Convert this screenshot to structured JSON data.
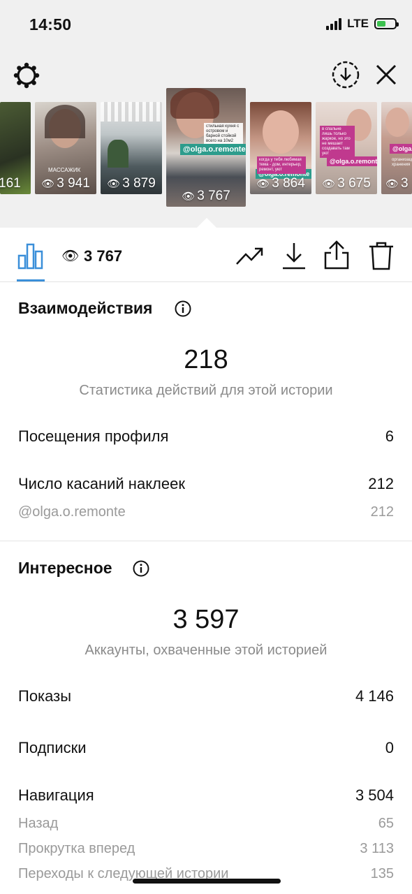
{
  "status_bar": {
    "time": "14:50",
    "network": "LTE",
    "battery_color": "#3cc14f"
  },
  "header": {
    "settings_icon": "gear-icon",
    "download_all_icon": "download-circle-icon",
    "close_icon": "close-icon"
  },
  "stories": [
    {
      "views": "161",
      "bg": "#3a4a2e"
    },
    {
      "views": "3 941",
      "bg": "#7a6e66",
      "caption": "МАССАЖИК"
    },
    {
      "views": "3 879",
      "bg": "#5a6a70"
    },
    {
      "views": "3 767",
      "bg": "#8a7f78",
      "handle": "@olga.o.remonte",
      "caption": "стильная кухня с островом и барной стойкой всего на 10м2",
      "selected": true
    },
    {
      "views": "3 864",
      "bg": "#a88c80",
      "handle": "@olga.o.remonte",
      "caption": "когда у тебя любимая тема - дом, интерьер, ремонт, уют"
    },
    {
      "views": "3 675",
      "bg": "#c9b8ae",
      "handle": "@olga.o.remonte",
      "caption": "в спальне лишь только жаркое, но это не мешает создавать там уют"
    },
    {
      "views": "3",
      "bg": "#b89a90",
      "handle": "@olga.o",
      "caption": "организация хранения"
    }
  ],
  "toolbar": {
    "views_count": "3 767",
    "active_tab_color": "#3b8fd9"
  },
  "interactions": {
    "title": "Взаимодействия",
    "total": "218",
    "caption": "Статистика действий для этой истории",
    "rows": [
      {
        "label": "Посещения профиля",
        "value": "6"
      },
      {
        "label": "Число касаний наклеек",
        "value": "212"
      }
    ],
    "sub_rows": [
      {
        "label": "@olga.o.remonte",
        "value": "212"
      }
    ]
  },
  "discovery": {
    "title": "Интересное",
    "total": "3 597",
    "caption": "Аккаунты, охваченные этой историей",
    "rows": [
      {
        "label": "Показы",
        "value": "4 146"
      },
      {
        "label": "Подписки",
        "value": "0"
      },
      {
        "label": "Навигация",
        "value": "3 504"
      }
    ],
    "sub_rows": [
      {
        "label": "Назад",
        "value": "65"
      },
      {
        "label": "Прокрутка вперед",
        "value": "3 113"
      },
      {
        "label": "Переходы к следующей истории",
        "value": "135"
      }
    ]
  }
}
